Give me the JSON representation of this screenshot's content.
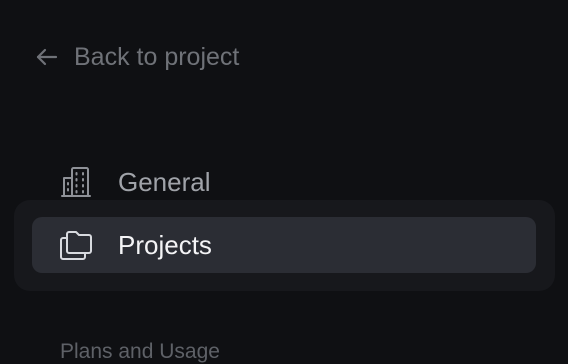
{
  "back_link": {
    "label": "Back to project",
    "icon": "arrow-left-icon"
  },
  "nav": {
    "items": [
      {
        "label": "General",
        "icon": "building-icon",
        "active": false
      },
      {
        "label": "Projects",
        "icon": "folders-icon",
        "active": true
      }
    ]
  },
  "section": {
    "heading": "Plans and Usage"
  },
  "colors": {
    "background": "#0f1013",
    "active_item": "#2b2d34",
    "active_container": "#17181c",
    "muted_text": "#6f7278"
  }
}
